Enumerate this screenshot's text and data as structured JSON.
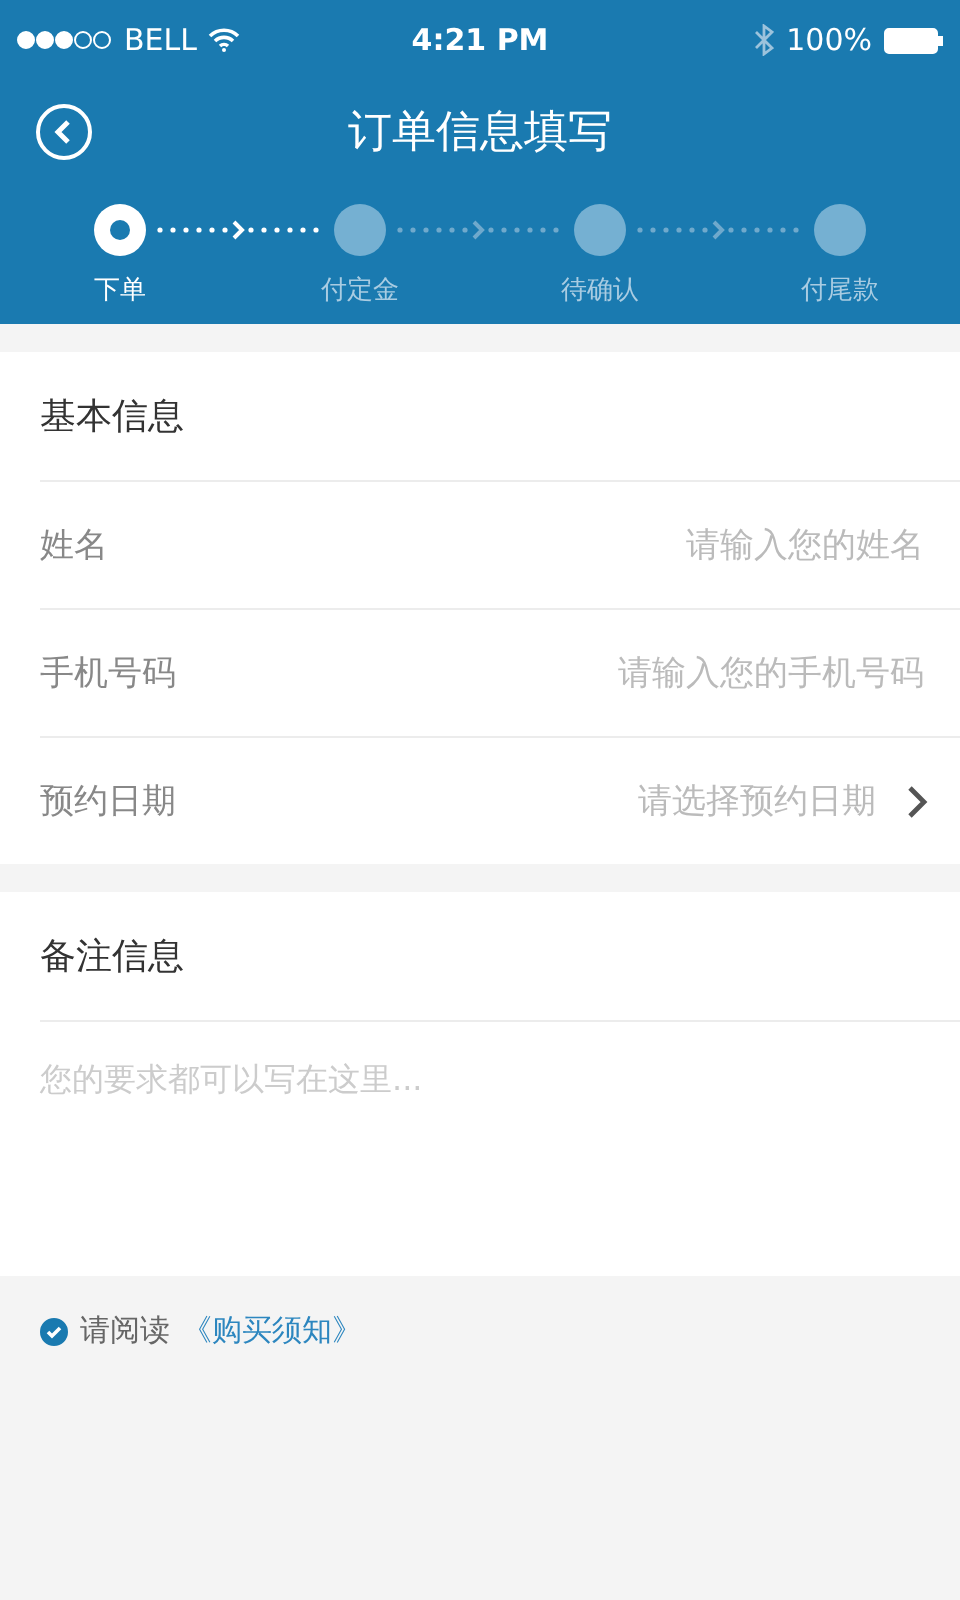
{
  "status_bar": {
    "carrier": "BELL",
    "time": "4:21 PM",
    "battery": "100%"
  },
  "nav": {
    "title": "订单信息填写"
  },
  "steps": [
    {
      "label": "下单",
      "selected": true
    },
    {
      "label": "付定金",
      "selected": false
    },
    {
      "label": "待确认",
      "selected": false
    },
    {
      "label": "付尾款",
      "selected": false
    }
  ],
  "basic_info": {
    "title": "基本信息",
    "fields": [
      {
        "kind": "input",
        "label": "姓名",
        "placeholder": "请输入您的姓名"
      },
      {
        "kind": "input",
        "label": "手机号码",
        "placeholder": "请输入您的手机号码"
      },
      {
        "kind": "select",
        "label": "预约日期",
        "placeholder": "请选择预约日期"
      }
    ]
  },
  "remarks": {
    "title": "备注信息",
    "placeholder": "您的要求都可以写在这里..."
  },
  "agreement": {
    "checked": true,
    "text": "请阅读",
    "link": "《购买须知》"
  }
}
